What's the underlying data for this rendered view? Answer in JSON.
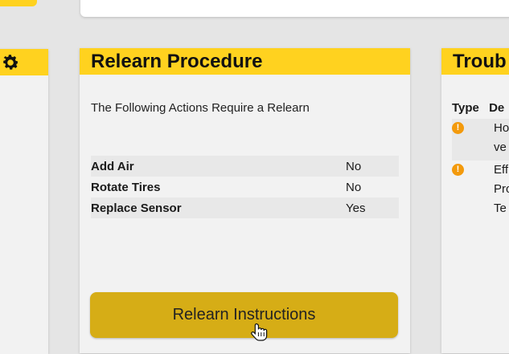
{
  "relearn": {
    "title": "Relearn Procedure",
    "subtitle": "The Following Actions Require a Relearn",
    "rows": [
      {
        "label": "Add Air",
        "value": "No"
      },
      {
        "label": "Rotate Tires",
        "value": "No"
      },
      {
        "label": "Replace Sensor",
        "value": "Yes"
      }
    ],
    "button_label": "Relearn Instructions"
  },
  "trouble": {
    "title": "Troub",
    "col_type": "Type",
    "col_desc": "De",
    "items": [
      {
        "lines": [
          "Ho",
          "ve"
        ]
      },
      {
        "lines": [
          "Eff",
          "Pro",
          "Te"
        ]
      }
    ]
  },
  "icons": {
    "settings": "gear-icon",
    "warning": "warning-icon",
    "cursor": "hand-cursor-icon"
  },
  "colors": {
    "accent": "#ffd21f",
    "button": "#d6ad16",
    "warning": "#f39a0c"
  }
}
